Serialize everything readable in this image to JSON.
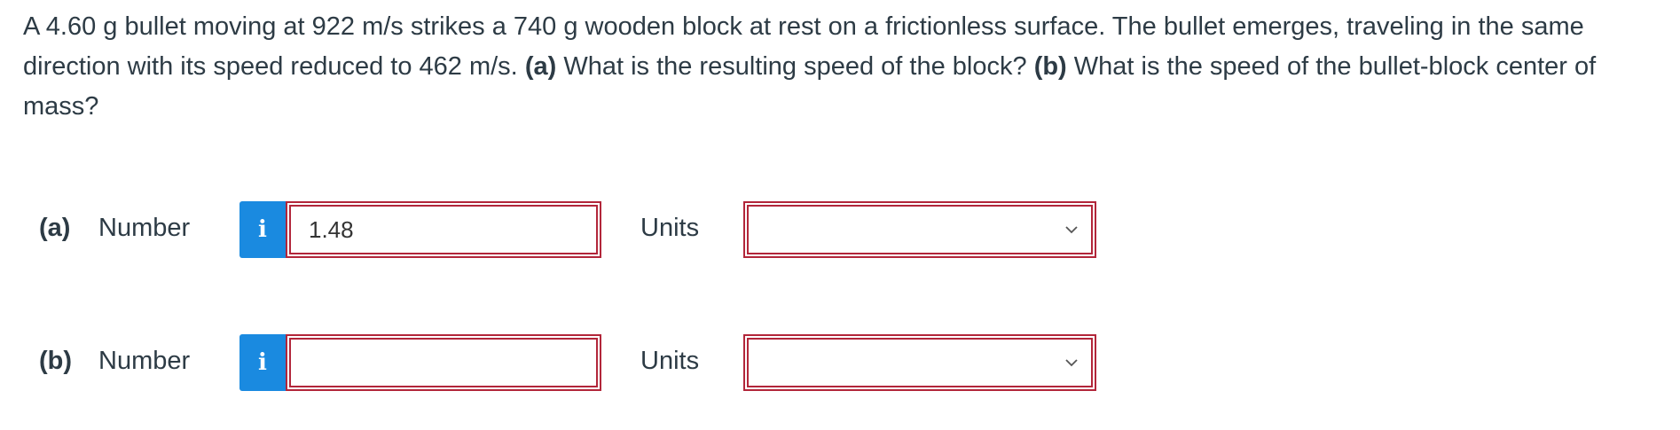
{
  "question": {
    "text_1": "A 4.60 g bullet moving at 922 m/s strikes a 740 g wooden block at rest on a frictionless surface. The bullet emerges, traveling in the same direction with its speed reduced to 462 m/s. ",
    "part_a_marker": "(a)",
    "text_2": " What is the resulting speed of the block? ",
    "part_b_marker": "(b)",
    "text_3": " What is the speed of the bullet-block center of mass?"
  },
  "parts": {
    "a": {
      "label": "(a)",
      "number_label": "Number",
      "info_icon": "i",
      "number_value": "1.48",
      "units_label": "Units",
      "units_value": ""
    },
    "b": {
      "label": "(b)",
      "number_label": "Number",
      "info_icon": "i",
      "number_value": "",
      "units_label": "Units",
      "units_value": ""
    }
  },
  "colors": {
    "info_button": "#1a8ae0",
    "error_border": "#b2263a",
    "text": "#2d3b45"
  }
}
